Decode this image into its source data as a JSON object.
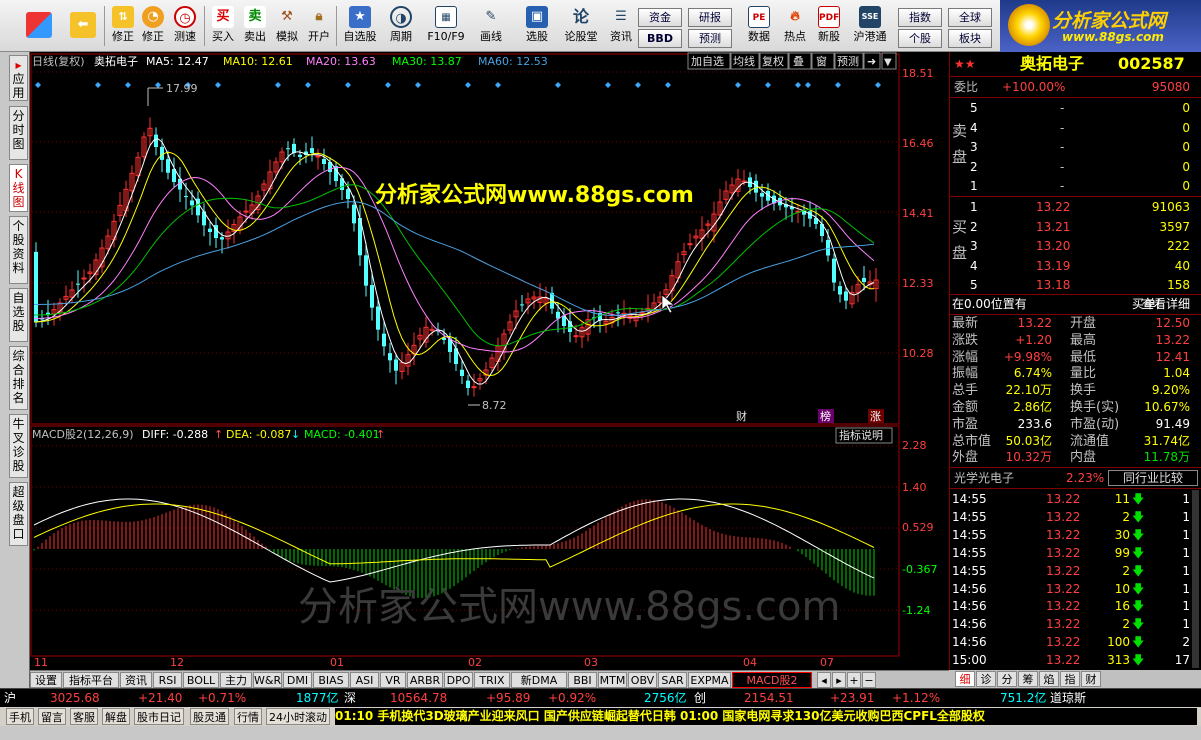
{
  "toolbar": {
    "buttons": [
      {
        "label": "",
        "icon": "start-icon"
      },
      {
        "label": "",
        "icon": "back-arrow-icon"
      },
      {
        "label": "修正",
        "icon": "up-down-arrow-icon"
      },
      {
        "label": "修正",
        "icon": "clock-icon"
      },
      {
        "label": "测速",
        "icon": "alarm-clock-icon"
      },
      {
        "label": "买入",
        "icon": "buy-icon"
      },
      {
        "label": "卖出",
        "icon": "sell-icon"
      },
      {
        "label": "模拟",
        "icon": "hammer-icon"
      },
      {
        "label": "开户",
        "icon": "lock-icon"
      },
      {
        "label": "自选股",
        "icon": "star-icon"
      },
      {
        "label": "周期",
        "icon": "clock-period-icon"
      },
      {
        "label": "F10/F9",
        "icon": "f10-icon"
      },
      {
        "label": "画线",
        "icon": "pencil-icon"
      },
      {
        "label": "选股",
        "icon": "picker-icon"
      },
      {
        "label": "论股堂",
        "icon": "forum-icon"
      },
      {
        "label": "资讯",
        "icon": "news-icon"
      },
      {
        "label": "数据",
        "icon": "pe-icon"
      },
      {
        "label": "热点",
        "icon": "hot-icon"
      },
      {
        "label": "新股",
        "icon": "pdf-icon"
      },
      {
        "label": "沪港通",
        "icon": "hk-icon"
      }
    ],
    "small": {
      "zijin": "资金",
      "bbd": "BBD",
      "yanbao": "研报",
      "yuce": "预测",
      "zhishu": "指数",
      "quanqiu": "全球",
      "gegu": "个股",
      "bankuai": "板块"
    }
  },
  "logo": {
    "title": "分析家公式网",
    "url": "www.88gs.com"
  },
  "left_tabs": [
    "应用",
    "分时图",
    "K线图",
    "个股资料",
    "自选股",
    "综合排名",
    "牛叉诊股",
    "超级盘口"
  ],
  "kline": {
    "header_period": "日线(复权)",
    "stock_name": "奥拓电子",
    "ma5": "MA5: 12.47",
    "ma10": "MA10: 12.61",
    "ma20": "MA20: 13.63",
    "ma30": "MA30: 13.87",
    "ma60": "MA60: 12.53",
    "btns": [
      "加自选",
      "均线",
      "复权",
      "叠",
      "窗",
      "预测"
    ],
    "high_label": "17.99",
    "low_label": "8.72",
    "yaxis": [
      "18.51",
      "16.46",
      "14.41",
      "12.33",
      "10.28"
    ],
    "markers": [
      "财",
      "榜",
      "涨"
    ],
    "watermark_top": "分析家公式网www.88gs.com",
    "colors": {
      "up": "#ff3030",
      "down": "#54ffff",
      "ma5": "#ffffff",
      "ma10": "#ffff00",
      "ma20": "#ff80ff",
      "ma30": "#00c000",
      "ma60": "#4aa0e0"
    }
  },
  "macd": {
    "title": "MACD股2(12,26,9)",
    "diff": "DIFF: -0.288",
    "dea": "DEA: -0.087",
    "macd": "MACD: -0.401",
    "explain": "指标说明",
    "yaxis": [
      "2.28",
      "1.40",
      "0.529",
      "-0.367",
      "-1.24"
    ],
    "watermark": "分析家公式网www.88gs.com"
  },
  "xaxis": [
    "11",
    "12",
    "01",
    "02",
    "03",
    "04",
    "07"
  ],
  "bottom_tabs": [
    "设置",
    "指标平台",
    "资讯",
    "RSI",
    "BOLL",
    "主力",
    "W&R",
    "DMI",
    "BIAS",
    "ASI",
    "VR",
    "ARBR",
    "DPO",
    "TRIX",
    "新DMA",
    "BBI",
    "MTM",
    "OBV",
    "SAR",
    "EXPMA",
    "MACD股2"
  ],
  "quote": {
    "name": "奥拓电子",
    "code": "002587",
    "weibi_label": "委比",
    "weibi": "+100.00%",
    "weicha": "95080",
    "sell_label": "卖盘",
    "buy_label": "买盘",
    "sells": [
      {
        "n": "5",
        "p": "-",
        "v": "0"
      },
      {
        "n": "4",
        "p": "-",
        "v": "0"
      },
      {
        "n": "3",
        "p": "-",
        "v": "0"
      },
      {
        "n": "2",
        "p": "-",
        "v": "0"
      },
      {
        "n": "1",
        "p": "-",
        "v": "0"
      }
    ],
    "buys": [
      {
        "n": "1",
        "p": "13.22",
        "v": "91063"
      },
      {
        "n": "2",
        "p": "13.21",
        "v": "3597"
      },
      {
        "n": "3",
        "p": "13.20",
        "v": "222"
      },
      {
        "n": "4",
        "p": "13.19",
        "v": "40"
      },
      {
        "n": "5",
        "p": "13.18",
        "v": "158"
      }
    ],
    "position": "在0.00位置有",
    "buy_one": "买单!",
    "view_detail": "查看详细",
    "stats": [
      {
        "l1": "最新",
        "v1": "13.22",
        "l2": "开盘",
        "v2": "12.50"
      },
      {
        "l1": "涨跌",
        "v1": "+1.20",
        "l2": "最高",
        "v2": "13.22"
      },
      {
        "l1": "涨幅",
        "v1": "+9.98%",
        "l2": "最低",
        "v2": "12.41"
      },
      {
        "l1": "振幅",
        "v1": "6.74%",
        "l2": "量比",
        "v2": "1.04"
      },
      {
        "l1": "总手",
        "v1": "22.10万",
        "l2": "换手",
        "v2": "9.20%"
      },
      {
        "l1": "金额",
        "v1": "2.86亿",
        "l2": "换手(实)",
        "v2": "10.67%"
      },
      {
        "l1": "市盈",
        "v1": "233.6",
        "l2": "市盈(动)",
        "v2": "91.49"
      },
      {
        "l1": "总市值",
        "v1": "50.03亿",
        "l2": "流通值",
        "v2": "31.74亿"
      },
      {
        "l1": "外盘",
        "v1": "10.32万",
        "l2": "内盘",
        "v2": "11.78万"
      }
    ],
    "industry": "光学光电子",
    "industry_pct": "2.23%",
    "peer_compare": "同行业比较",
    "ticks": [
      {
        "t": "14:55",
        "p": "13.22",
        "v": "11",
        "s": "1"
      },
      {
        "t": "14:55",
        "p": "13.22",
        "v": "2",
        "s": "1"
      },
      {
        "t": "14:55",
        "p": "13.22",
        "v": "30",
        "s": "1"
      },
      {
        "t": "14:55",
        "p": "13.22",
        "v": "99",
        "s": "1"
      },
      {
        "t": "14:55",
        "p": "13.22",
        "v": "2",
        "s": "1"
      },
      {
        "t": "14:56",
        "p": "13.22",
        "v": "10",
        "s": "1"
      },
      {
        "t": "14:56",
        "p": "13.22",
        "v": "16",
        "s": "1"
      },
      {
        "t": "14:56",
        "p": "13.22",
        "v": "2",
        "s": "1"
      },
      {
        "t": "14:56",
        "p": "13.22",
        "v": "100",
        "s": "2"
      },
      {
        "t": "15:00",
        "p": "13.22",
        "v": "313",
        "s": "17"
      }
    ],
    "tabs": [
      "细",
      "诊",
      "分",
      "筹",
      "焰",
      "指",
      "财"
    ]
  },
  "index": {
    "sh_label": "沪",
    "sh": "3025.68",
    "sh_chg": "+21.40",
    "sh_pct": "+0.71%",
    "sh_amt": "1877亿",
    "sz_label": "深",
    "sz": "10564.78",
    "sz_chg": "+95.89",
    "sz_pct": "+0.92%",
    "sz_amt": "2756亿",
    "cy_label": "创",
    "cy": "2154.51",
    "cy_chg": "+23.91",
    "cy_pct": "+1.12%",
    "cy_amt": "751.2亿",
    "dj": "道琼斯"
  },
  "status": {
    "items": [
      "手机",
      "留言",
      "客服",
      "解盘",
      "股市日记",
      "股灵通",
      "行情",
      "24小时滚动"
    ],
    "news": "01:10 手机换代3D玻璃产业迎来风口 国产供应链崛起替代日韩          01:00 国家电网寻求130亿美元收购巴西CPFL全部股权"
  }
}
